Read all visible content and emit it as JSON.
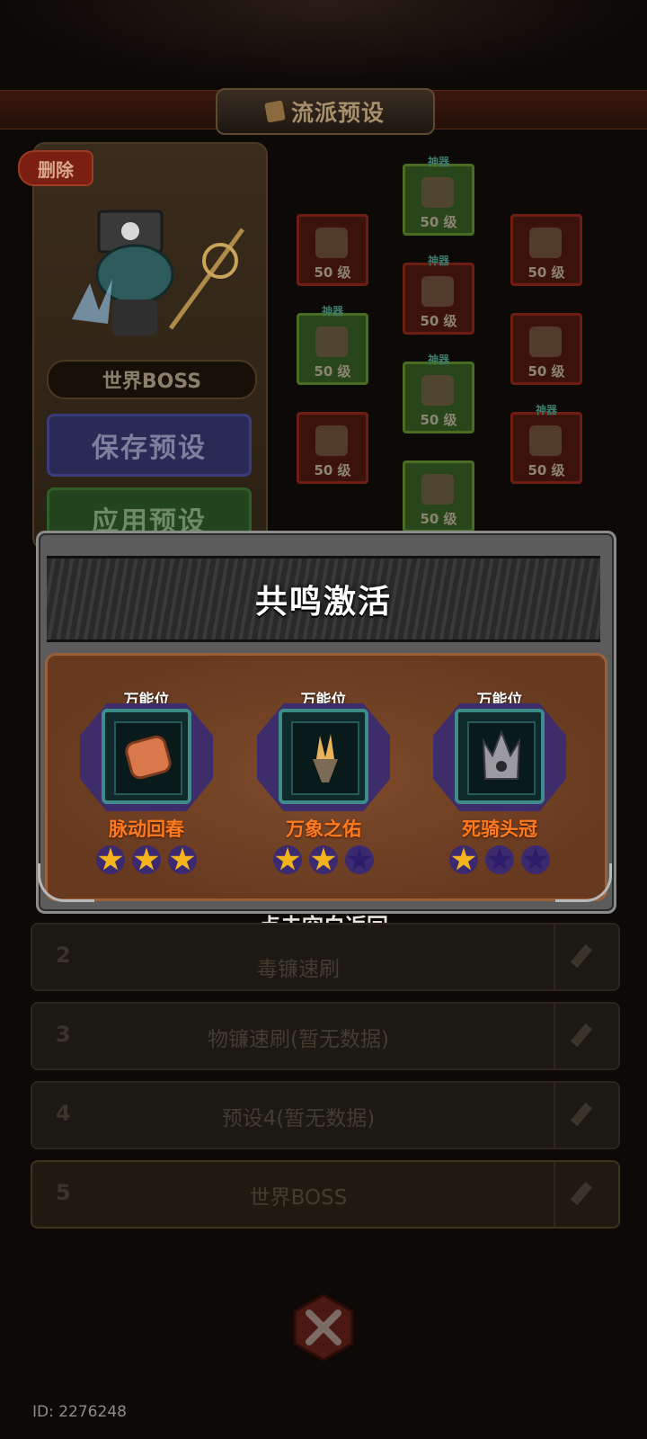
{
  "title": "流派预设",
  "delete_label": "删除",
  "preset_name": "世界BOSS",
  "save_label": "保存预设",
  "apply_label": "应用预设",
  "equipment": {
    "level_label": "50 级",
    "divine_tag": "神器"
  },
  "modal": {
    "title": "共鸣激活",
    "items": [
      {
        "slot": "万能位",
        "name": "脉动回春",
        "stars": 3,
        "max_stars": 3
      },
      {
        "slot": "万能位",
        "name": "万象之佑",
        "stars": 2,
        "max_stars": 3
      },
      {
        "slot": "万能位",
        "name": "死骑头冠",
        "stars": 1,
        "max_stars": 3
      }
    ],
    "dismiss_hint": "点击空白返回"
  },
  "preset_list": [
    {
      "num": "2",
      "label": "毒镰速刷"
    },
    {
      "num": "3",
      "label": "物镰速刷(暂无数据)"
    },
    {
      "num": "4",
      "label": "预设4(暂无数据)"
    },
    {
      "num": "5",
      "label": "世界BOSS"
    }
  ],
  "id_label": "ID: 2276248",
  "colors": {
    "accent_orange": "#ff7a1f",
    "star_on": "#f3b31c",
    "star_off": "#2b1d69",
    "modal_body": "#673a20"
  }
}
